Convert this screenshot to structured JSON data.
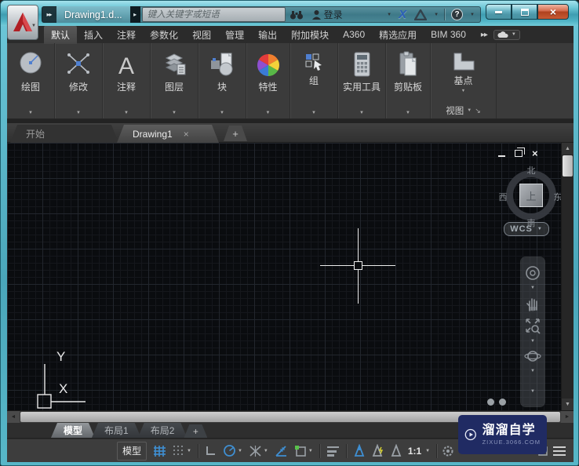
{
  "titlebar": {
    "doc_title": "Drawing1.d...",
    "search_placeholder": "键入关键字或短语",
    "login_label": "登录",
    "exchange_x": "X",
    "help_q": "?"
  },
  "icons": {
    "dropdown": "▼",
    "flyout_right": "▸",
    "overflow_right": "»",
    "dialog_launcher": "↘",
    "close": "×",
    "plus": "+",
    "annotate_letter": "A",
    "left_arrow": "◄",
    "right_arrow": "►",
    "up_arrow": "▲",
    "down_arrow": "▼"
  },
  "ribbon": {
    "tabs": [
      "默认",
      "插入",
      "注释",
      "参数化",
      "视图",
      "管理",
      "输出",
      "附加模块",
      "A360",
      "精选应用",
      "BIM 360"
    ],
    "active_tab": "默认",
    "panels": [
      "绘图",
      "修改",
      "注释",
      "图层",
      "块",
      "特性",
      "组",
      "实用工具",
      "剪贴板"
    ],
    "base_button": "基点",
    "view_panel": "视图"
  },
  "file_tabs": {
    "start": "开始",
    "drawing": "Drawing1"
  },
  "canvas": {
    "viewcube": {
      "north": "北",
      "south": "南",
      "west": "西",
      "east": "东",
      "top": "上"
    },
    "wcs": "WCS",
    "ucs": {
      "x": "X",
      "y": "Y"
    }
  },
  "layout_tabs": {
    "model": "模型",
    "layout1": "布局1",
    "layout2": "布局2"
  },
  "statusbar": {
    "model": "模型",
    "scale": "1:1"
  },
  "watermark": {
    "title": "溜溜自学",
    "site": "zixue.3066.com"
  },
  "colors": {
    "accent_blue": "#3f8fd2",
    "titlebar_teal": "#4fb3c5",
    "watermark_navy": "#202b63",
    "close_red": "#bb4a2d",
    "canvas_bg": "#0a0c0f"
  }
}
